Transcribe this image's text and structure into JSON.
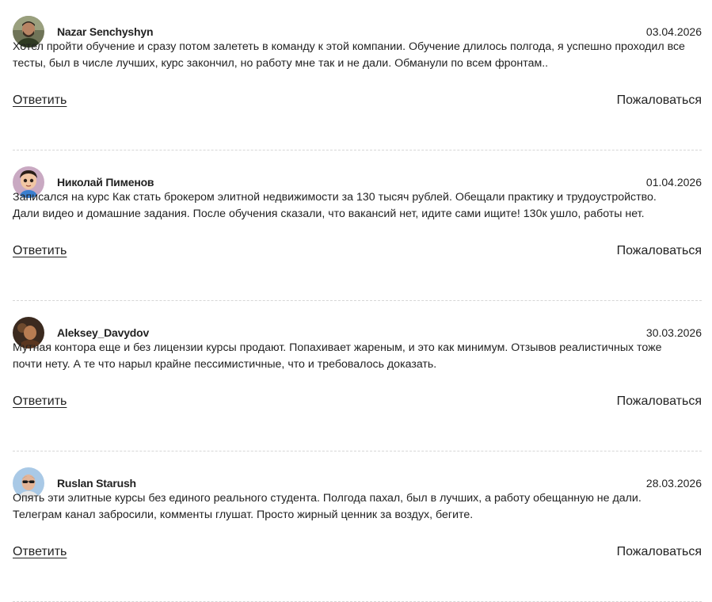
{
  "reviews": [
    {
      "author": "Nazar Senchyshyn",
      "date": "03.04.2026",
      "avatar_icon": "person-photo",
      "text": "Хотел пройти обучение и сразу потом залететь в команду к этой компании. Обучение длилось полгода, я успешно проходил все тесты, был в числе лучших, курс закончил, но работу мне так и не дали. Обманули по всем фронтам..",
      "reply_label": "Ответить",
      "report_label": "Пожаловаться"
    },
    {
      "author": "Николай Пименов",
      "date": "01.04.2026",
      "avatar_icon": "cartoon-avatar",
      "text": "Записался на курс Как стать брокером элитной недвижимости за 130 тысяч рублей. Обещали практику и трудоустройство. Дали видео и домашние задания. После обучения сказали, что вакансий нет, идите сами ищите! 130к ушло, работы нет.",
      "reply_label": "Ответить",
      "report_label": "Пожаловаться"
    },
    {
      "author": "Aleksey_Davydov",
      "date": "30.03.2026",
      "avatar_icon": "person-photo",
      "text": "Мутная контора еще и без лицензии курсы продают. Попахивает жареным, и это как минимум. Отзывов реалистичных тоже почти нету. А те что нарыл крайне пессимистичные, что и требовалось доказать.",
      "reply_label": "Ответить",
      "report_label": "Пожаловаться"
    },
    {
      "author": "Ruslan Starush",
      "date": "28.03.2026",
      "avatar_icon": "person-photo",
      "text": "Опять эти элитные курсы без единого реального студента. Полгода пахал, был в лучших, а работу обещанную не дали. Телеграм канал забросили, комменты глушат. Просто жирный ценник за воздух, бегите.",
      "reply_label": "Ответить",
      "report_label": "Пожаловаться"
    }
  ]
}
